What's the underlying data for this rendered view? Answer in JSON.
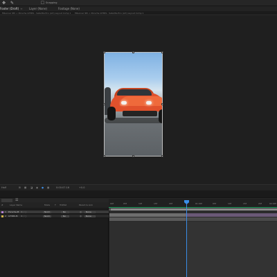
{
  "topbar": {
    "icons": [
      "tool-icon",
      "brush-icon"
    ],
    "snapping_label": "Snapping"
  },
  "tabs": [
    {
      "label": "Footer (Draft)",
      "active": true
    },
    {
      "label": "Layer (None)",
      "active": false
    },
    {
      "label": "Footage (None)",
      "active": false
    }
  ],
  "crumbs": [
    "Mbunner 9th < Porsche GT3RS - Satellite Eco (Art) Layout Comp 1",
    "Mbunner 9th < Porsche GT3RS - Satellite Eco (Art) Layout Comp 1"
  ],
  "viewer_toolbar": {
    "zoom": "Half",
    "timecode": "0:00:07:16",
    "exposure": "+0.0"
  },
  "timeline": {
    "ruler_ticks": [
      "00f",
      "05f",
      "10f",
      "15f",
      "20f",
      "01:00f",
      "05f",
      "10f",
      "15f",
      "20f",
      "02:00f"
    ],
    "columns": [
      "#",
      "Layer Name",
      "Mode",
      "T",
      "TrkMat",
      "Parent & Link"
    ],
    "layers": [
      {
        "num": "1",
        "name": "Porsche.M",
        "mode": "Norm",
        "trkmat": "No",
        "parent": "None",
        "color": "#b37fd0",
        "selected": true
      },
      {
        "num": "2",
        "name": "GT3RS.M",
        "mode": "Norm",
        "trkmat": "No",
        "parent": "None",
        "color": "#d1b34a",
        "selected": false
      }
    ]
  },
  "colors": {
    "accent": "#3a8ee8",
    "work_area": "#1f9f5f",
    "car": "#e0512c"
  }
}
